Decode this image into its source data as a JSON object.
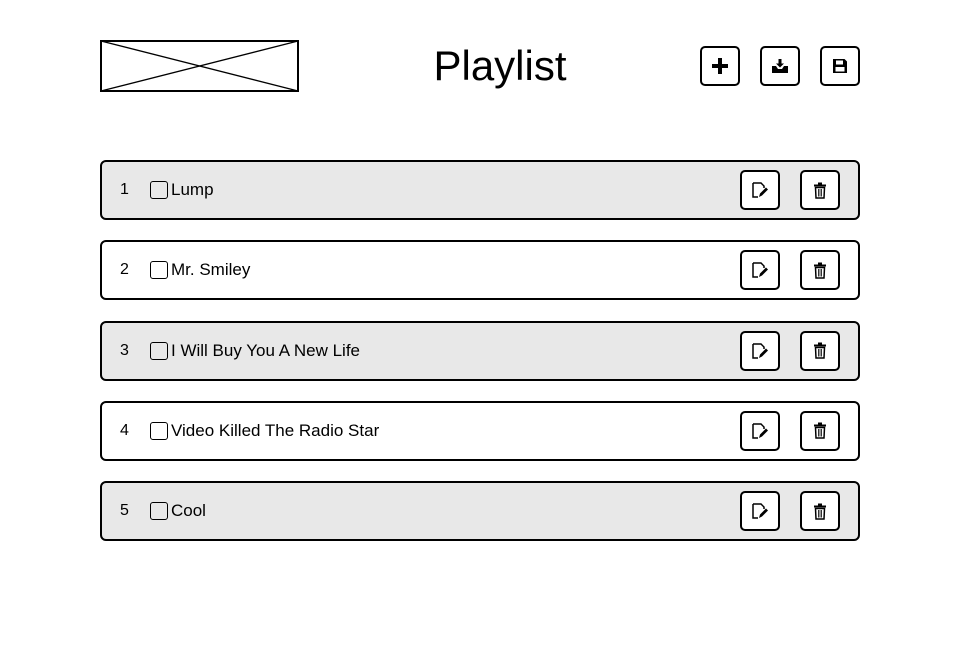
{
  "header": {
    "title": "Playlist",
    "actions": [
      {
        "icon": "plus-icon"
      },
      {
        "icon": "download-tray-icon"
      },
      {
        "icon": "floppy-disk-icon"
      }
    ]
  },
  "playlist": {
    "songs": [
      {
        "index": "1",
        "title": "Lump",
        "checked": false
      },
      {
        "index": "2",
        "title": "Mr. Smiley",
        "checked": false
      },
      {
        "index": "3",
        "title": "I Will Buy You A New Life",
        "checked": false
      },
      {
        "index": "4",
        "title": "Video Killed The Radio Star",
        "checked": false
      },
      {
        "index": "5",
        "title": "Cool",
        "checked": false
      }
    ],
    "row_actions": [
      "edit-icon",
      "trash-icon"
    ]
  },
  "colors": {
    "row_shaded": "#e8e8e8",
    "row_plain": "#ffffff",
    "border": "#000000"
  }
}
